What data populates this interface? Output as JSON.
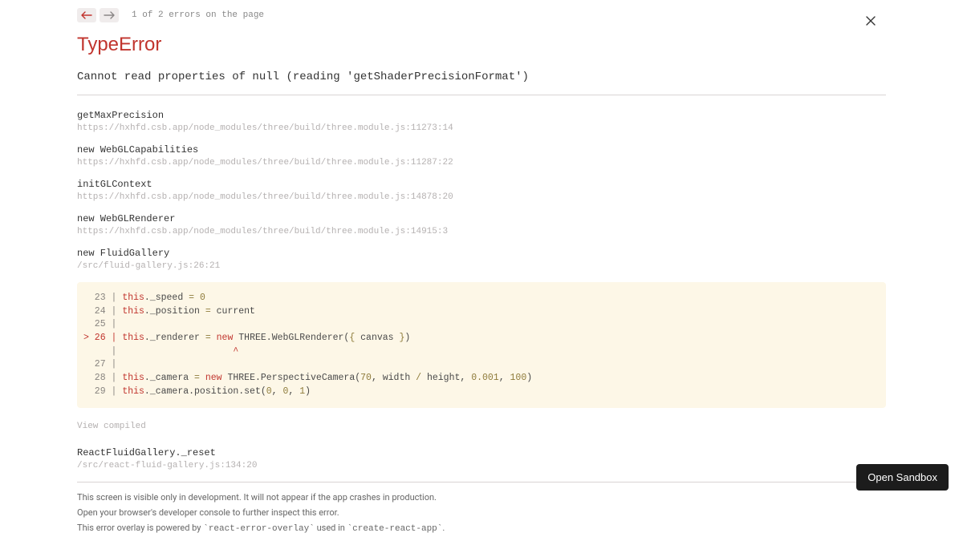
{
  "nav": {
    "count_text": "1 of 2 errors on the page"
  },
  "error": {
    "type": "TypeError",
    "message": "Cannot read properties of null (reading 'getShaderPrecisionFormat')"
  },
  "stack": [
    {
      "fn": "getMaxPrecision",
      "loc": "https://hxhfd.csb.app/node_modules/three/build/three.module.js:11273:14"
    },
    {
      "fn": "new WebGLCapabilities",
      "loc": "https://hxhfd.csb.app/node_modules/three/build/three.module.js:11287:22"
    },
    {
      "fn": "initGLContext",
      "loc": "https://hxhfd.csb.app/node_modules/three/build/three.module.js:14878:20"
    },
    {
      "fn": "new WebGLRenderer",
      "loc": "https://hxhfd.csb.app/node_modules/three/build/three.module.js:14915:3"
    },
    {
      "fn": "new FluidGallery",
      "loc": "/src/fluid-gallery.js:26:21"
    }
  ],
  "code": {
    "lines": [
      {
        "gutter": "  23 | ",
        "tokens": [
          [
            "kw",
            "this"
          ],
          [
            "plain",
            "._speed "
          ],
          [
            "op",
            "="
          ],
          [
            "plain",
            " "
          ],
          [
            "num",
            "0"
          ]
        ]
      },
      {
        "gutter": "  24 | ",
        "tokens": [
          [
            "kw",
            "this"
          ],
          [
            "plain",
            "._position "
          ],
          [
            "op",
            "="
          ],
          [
            "plain",
            " current"
          ]
        ]
      },
      {
        "gutter": "  25 | ",
        "tokens": []
      },
      {
        "gutter": "> 26 | ",
        "gutter_class": "err",
        "tokens": [
          [
            "kw",
            "this"
          ],
          [
            "plain",
            "._renderer "
          ],
          [
            "op",
            "="
          ],
          [
            "plain",
            " "
          ],
          [
            "kw",
            "new"
          ],
          [
            "plain",
            " THREE"
          ],
          [
            "plain",
            "."
          ],
          [
            "plain",
            "WebGLRenderer"
          ],
          [
            "plain",
            "("
          ],
          [
            "op",
            "{"
          ],
          [
            "plain",
            " canvas "
          ],
          [
            "op",
            "}"
          ],
          [
            "plain",
            ")"
          ]
        ]
      },
      {
        "gutter": "     | ",
        "tokens": [
          [
            "err",
            "                    ^"
          ]
        ]
      },
      {
        "gutter": "  27 | ",
        "tokens": []
      },
      {
        "gutter": "  28 | ",
        "tokens": [
          [
            "kw",
            "this"
          ],
          [
            "plain",
            "._camera "
          ],
          [
            "op",
            "="
          ],
          [
            "plain",
            " "
          ],
          [
            "kw",
            "new"
          ],
          [
            "plain",
            " THREE"
          ],
          [
            "plain",
            "."
          ],
          [
            "plain",
            "PerspectiveCamera"
          ],
          [
            "plain",
            "("
          ],
          [
            "num",
            "70"
          ],
          [
            "plain",
            ", width "
          ],
          [
            "op",
            "/"
          ],
          [
            "plain",
            " height, "
          ],
          [
            "num",
            "0.001"
          ],
          [
            "plain",
            ", "
          ],
          [
            "num",
            "100"
          ],
          [
            "plain",
            ")"
          ]
        ]
      },
      {
        "gutter": "  29 | ",
        "tokens": [
          [
            "kw",
            "this"
          ],
          [
            "plain",
            "._camera.position.set("
          ],
          [
            "num",
            "0"
          ],
          [
            "plain",
            ", "
          ],
          [
            "num",
            "0"
          ],
          [
            "plain",
            ", "
          ],
          [
            "num",
            "1"
          ],
          [
            "plain",
            ")"
          ]
        ]
      }
    ]
  },
  "view_compiled": "View compiled",
  "post_stack": {
    "fn": "ReactFluidGallery._reset",
    "loc": "/src/react-fluid-gallery.js:134:20"
  },
  "footer": {
    "l1": "This screen is visible only in development. It will not appear if the app crashes in production.",
    "l2": "Open your browser's developer console to further inspect this error.",
    "l3_pre": "This error overlay is powered by ",
    "l3_c1": "`react-error-overlay`",
    "l3_mid": " used in ",
    "l3_c2": "`create-react-app`",
    "l3_post": "."
  },
  "sandbox_button": "Open Sandbox"
}
